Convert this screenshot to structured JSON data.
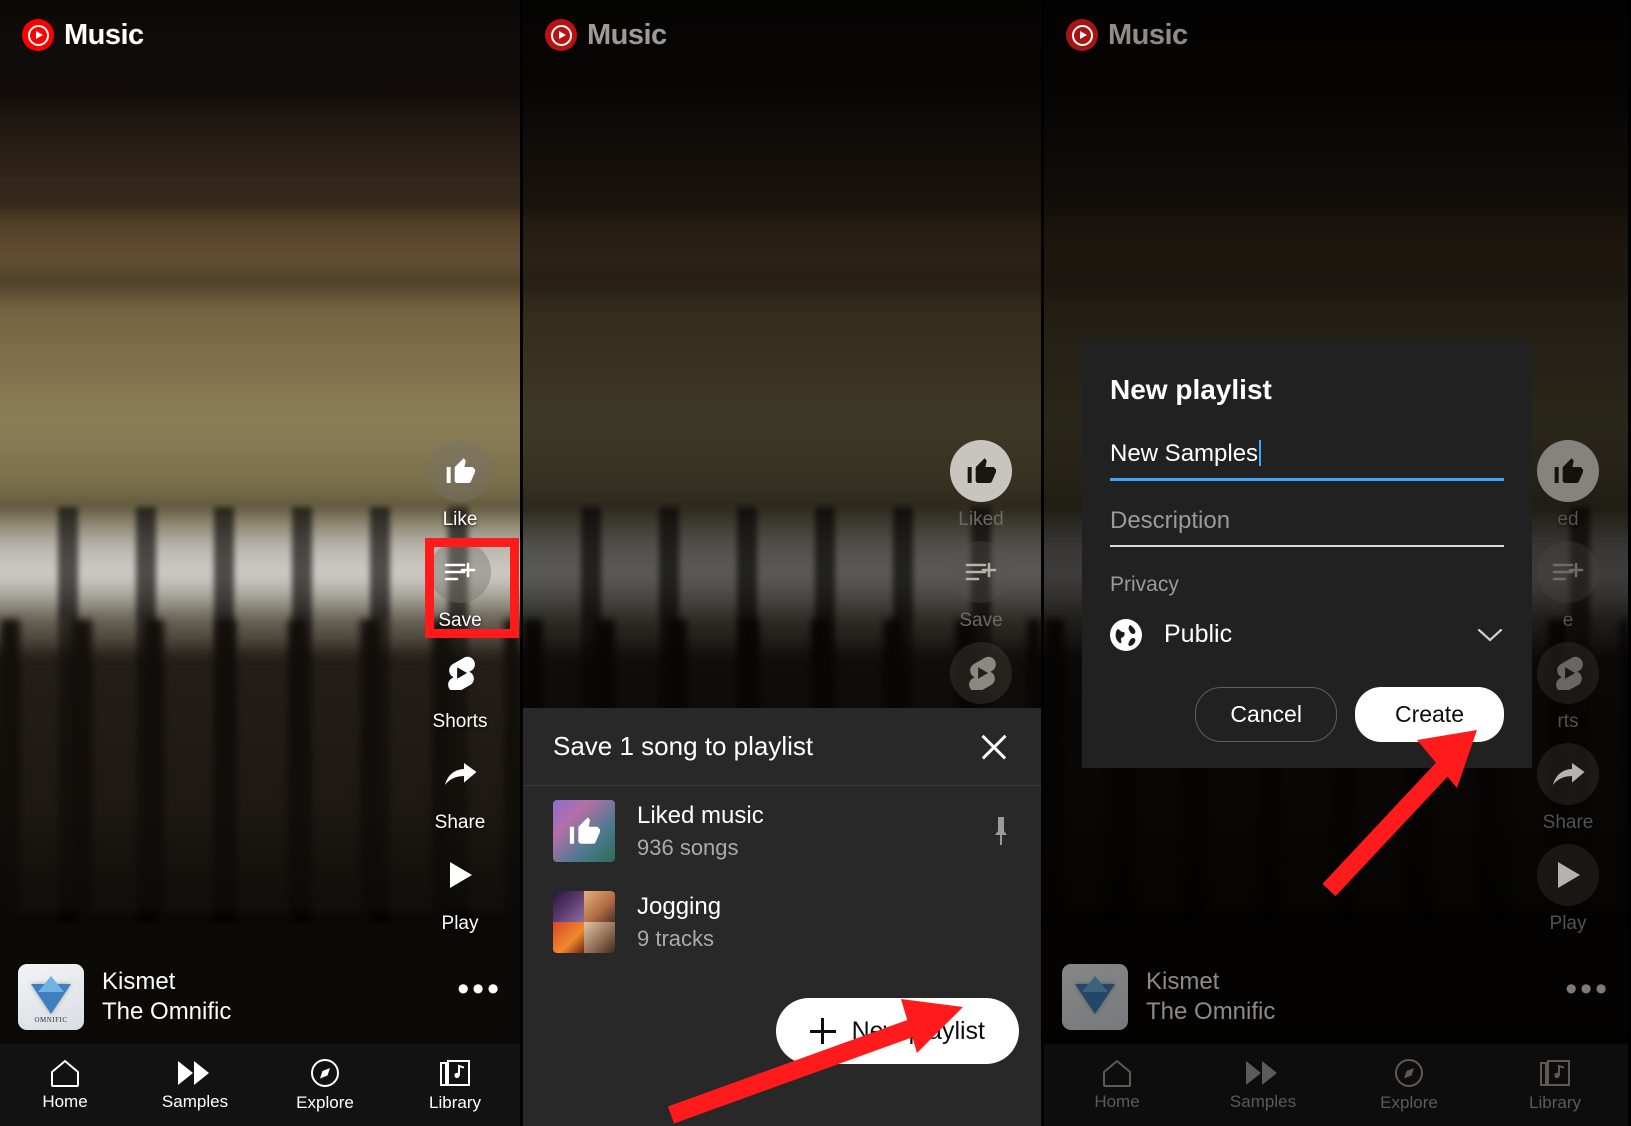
{
  "app": {
    "brand": "Music",
    "logo_icon": "youtube-music-logo-icon",
    "accent_red": "#ff0000",
    "annotation_red": "#ff1b1b",
    "accent_blue": "#3ea6ff"
  },
  "panel1": {
    "actions": [
      {
        "label": "Like",
        "icon": "thumbs-up-icon"
      },
      {
        "label": "Save",
        "icon": "save-to-playlist-icon"
      },
      {
        "label": "Shorts",
        "icon": "shorts-icon"
      },
      {
        "label": "Share",
        "icon": "share-arrow-icon"
      },
      {
        "label": "Play",
        "icon": "play-triangle-icon"
      }
    ],
    "mini_player": {
      "title": "Kismet",
      "artist": "The Omnific",
      "artwork_caption": "OMNIFIC",
      "overflow_icon": "more-horizontal-icon"
    },
    "nav": [
      {
        "label": "Home",
        "icon": "home-icon"
      },
      {
        "label": "Samples",
        "icon": "samples-double-play-icon"
      },
      {
        "label": "Explore",
        "icon": "explore-compass-icon"
      },
      {
        "label": "Library",
        "icon": "library-icon"
      }
    ]
  },
  "panel2": {
    "actions": [
      {
        "label": "Liked",
        "icon": "thumbs-up-filled-icon"
      },
      {
        "label": "Save",
        "icon": "save-to-playlist-icon"
      },
      {
        "label": "",
        "icon": "shorts-icon"
      }
    ],
    "sheet": {
      "title": "Save 1 song to playlist",
      "close_icon": "close-icon",
      "playlists": [
        {
          "name": "Liked music",
          "count": "936 songs",
          "thumb": "liked-music-thumb",
          "pin_icon": "pin-icon"
        },
        {
          "name": "Jogging",
          "count": "9 tracks",
          "thumb": "jogging-collage-thumb"
        }
      ],
      "new_playlist_button": {
        "label": "New playlist",
        "icon": "plus-icon"
      }
    }
  },
  "panel3": {
    "dialog": {
      "title": "New playlist",
      "name_value": "New Samples",
      "description_placeholder": "Description",
      "description_value": "",
      "privacy_label": "Privacy",
      "privacy_value": "Public",
      "privacy_icon": "globe-icon",
      "privacy_chevron_icon": "chevron-down-icon",
      "cancel_label": "Cancel",
      "create_label": "Create"
    },
    "actions": [
      {
        "label": "ed"
      },
      {
        "label": "e"
      },
      {
        "label": "rts"
      },
      {
        "label": "Share",
        "icon": "share-arrow-icon"
      },
      {
        "label": "Play",
        "icon": "play-triangle-icon"
      }
    ],
    "mini_player": {
      "title": "Kismet",
      "artist": "The Omnific",
      "overflow_icon": "more-horizontal-icon"
    },
    "nav": [
      {
        "label": "Home",
        "icon": "home-icon"
      },
      {
        "label": "Samples",
        "icon": "samples-double-play-icon"
      },
      {
        "label": "Explore",
        "icon": "explore-compass-icon"
      },
      {
        "label": "Library",
        "icon": "library-icon"
      }
    ]
  },
  "annotations": {
    "save_highlight_box": "red-rectangle-highlight",
    "arrow_to_new_playlist": "red-arrow-annotation",
    "arrow_to_create": "red-arrow-annotation"
  }
}
